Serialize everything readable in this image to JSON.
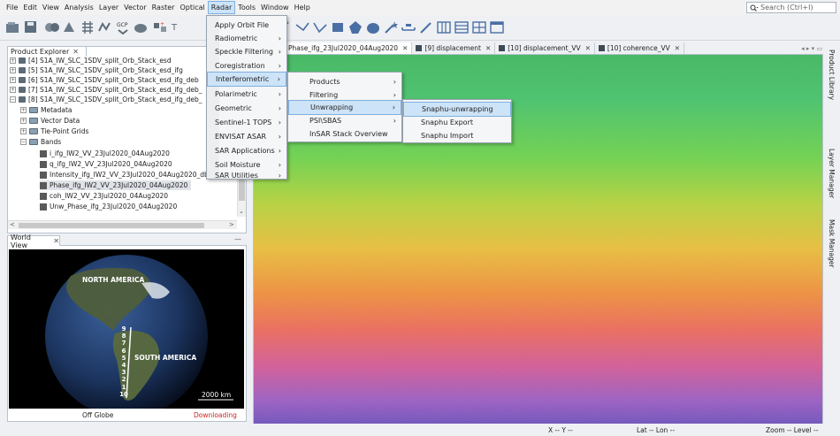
{
  "menubar": {
    "items": [
      "File",
      "Edit",
      "View",
      "Analysis",
      "Layer",
      "Vector",
      "Raster",
      "Optical",
      "Radar",
      "Tools",
      "Window",
      "Help"
    ],
    "active_index": 8
  },
  "search": {
    "placeholder": "Search (Ctrl+I)"
  },
  "product_explorer": {
    "title": "Product Explorer",
    "products": [
      "[4] S1A_IW_SLC_1SDV_split_Orb_Stack_esd",
      "[5] S1A_IW_SLC_1SDV_split_Orb_Stack_esd_ifg",
      "[6] S1A_IW_SLC_1SDV_split_Orb_Stack_esd_ifg_deb",
      "[7] S1A_IW_SLC_1SDV_split_Orb_Stack_esd_ifg_deb_",
      "[8] S1A_IW_SLC_1SDV_split_Orb_Stack_esd_ifg_deb_"
    ],
    "folders": [
      "Metadata",
      "Vector Data",
      "Tie-Point Grids",
      "Bands"
    ],
    "bands": [
      "i_ifg_IW2_VV_23Jul2020_04Aug2020",
      "q_ifg_IW2_VV_23Jul2020_04Aug2020",
      "Intensity_ifg_IW2_VV_23Jul2020_04Aug2020_db",
      "Phase_ifg_IW2_VV_23Jul2020_04Aug2020",
      "coh_IW2_VV_23Jul2020_04Aug2020",
      "Unw_Phase_ifg_23Jul2020_04Aug2020"
    ]
  },
  "world_view": {
    "title": "World View",
    "labels": {
      "north_america": "NORTH AMERICA",
      "south_america": "SOUTH AMERICA",
      "scale": "2000 km"
    },
    "track_numbers": [
      "9",
      "8",
      "7",
      "6",
      "5",
      "4",
      "3",
      "2",
      "1",
      "10"
    ],
    "status_left": "Off Globe",
    "status_right": "Downloading",
    "status_right_color": "#cc2222"
  },
  "image_tabs": [
    {
      "label": "Phase_ifg_23Jul2020_04Aug2020"
    },
    {
      "label": "[9] displacement"
    },
    {
      "label": "[10] displacement_VV"
    },
    {
      "label": "[10] coherence_VV"
    }
  ],
  "right_panels": [
    "Product Library",
    "Layer Manager",
    "Mask Manager"
  ],
  "radar_menu": {
    "items": [
      {
        "label": "Apply Orbit File",
        "submenu": false
      },
      {
        "label": "Radiometric",
        "submenu": true
      },
      {
        "label": "Speckle Filtering",
        "submenu": true
      },
      {
        "label": "Coregistration",
        "submenu": true
      },
      {
        "label": "Interferometric",
        "submenu": true
      },
      {
        "label": "Polarimetric",
        "submenu": true
      },
      {
        "label": "Geometric",
        "submenu": true
      },
      {
        "label": "Sentinel-1 TOPS",
        "submenu": true
      },
      {
        "label": "ENVISAT ASAR",
        "submenu": true
      },
      {
        "label": "SAR Applications",
        "submenu": true
      },
      {
        "label": "Soil Moisture",
        "submenu": true
      },
      {
        "label": "SAR Utilities",
        "submenu": true
      }
    ]
  },
  "interferometric_menu": {
    "items": [
      {
        "label": "Products",
        "submenu": true
      },
      {
        "label": "Filtering",
        "submenu": true
      },
      {
        "label": "Unwrapping",
        "submenu": true
      },
      {
        "label": "PSI\\SBAS",
        "submenu": true
      },
      {
        "label": "InSAR Stack Overview",
        "submenu": false
      }
    ]
  },
  "unwrapping_menu": {
    "items": [
      {
        "label": "Snaphu-unwrapping"
      },
      {
        "label": "Snaphu Export"
      },
      {
        "label": "Snaphu Import"
      }
    ]
  },
  "statusbar": {
    "x": "X  --  Y  --",
    "latlon": "Lat  -- Lon  --",
    "zoom": "Zoom -- Level --"
  }
}
